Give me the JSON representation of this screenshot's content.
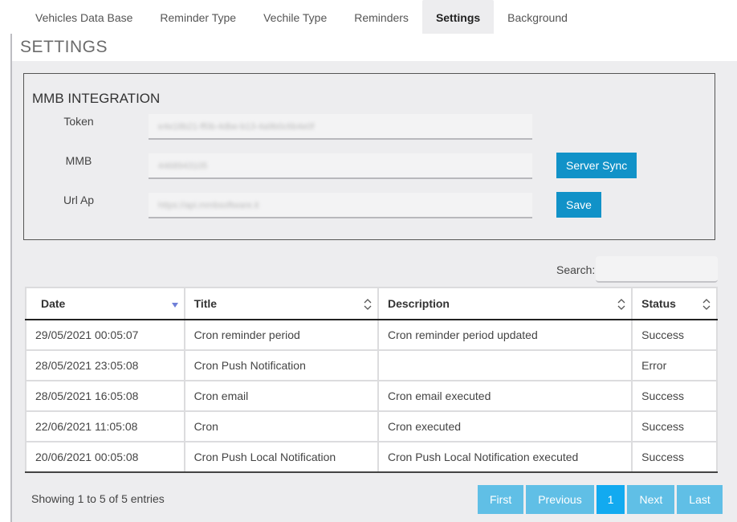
{
  "tabs": [
    {
      "label": "Vehicles Data Base"
    },
    {
      "label": "Reminder Type"
    },
    {
      "label": "Vechile Type"
    },
    {
      "label": "Reminders"
    },
    {
      "label": "Settings",
      "active": true
    },
    {
      "label": "Background"
    }
  ],
  "page": {
    "title": "SETTINGS"
  },
  "mmb": {
    "title": "MMB INTEGRATION",
    "token_label": "Token",
    "token_value": "e4e18b21-ff0b-4dbe-b13-4a9b0c6b4e0f",
    "mmb_label": "MMB",
    "mmb_value": "4468943105",
    "url_label": "Url Ap",
    "url_value": "https://api.mmbsoftware.it",
    "server_sync_label": "Server Sync",
    "save_label": "Save"
  },
  "search": {
    "label": "Search:",
    "value": ""
  },
  "table": {
    "columns": [
      "Date",
      "Title",
      "Description",
      "Status"
    ],
    "sort_column": "Date",
    "rows": [
      {
        "date": "29/05/2021 00:05:07",
        "title": "Cron reminder period",
        "description": "Cron reminder period updated",
        "status": "Success"
      },
      {
        "date": "28/05/2021 23:05:08",
        "title": "Cron Push Notification",
        "description": "",
        "status": "Error"
      },
      {
        "date": "28/05/2021 16:05:08",
        "title": "Cron email",
        "description": "Cron email executed",
        "status": "Success"
      },
      {
        "date": "22/06/2021 11:05:08",
        "title": "Cron",
        "description": "Cron executed",
        "status": "Success"
      },
      {
        "date": "20/06/2021 00:05:08",
        "title": "Cron Push Local Notification",
        "description": "Cron Push Local Notification executed",
        "status": "Success"
      }
    ]
  },
  "footer": {
    "info": "Showing 1 to 5 of 5 entries",
    "pagination": {
      "first": "First",
      "previous": "Previous",
      "current": "1",
      "next": "Next",
      "last": "Last"
    }
  },
  "colors": {
    "accent": "#1192c8",
    "page_button": "#60bfe6",
    "current_page": "#12aaf0",
    "panel_bg": "#ededef"
  }
}
